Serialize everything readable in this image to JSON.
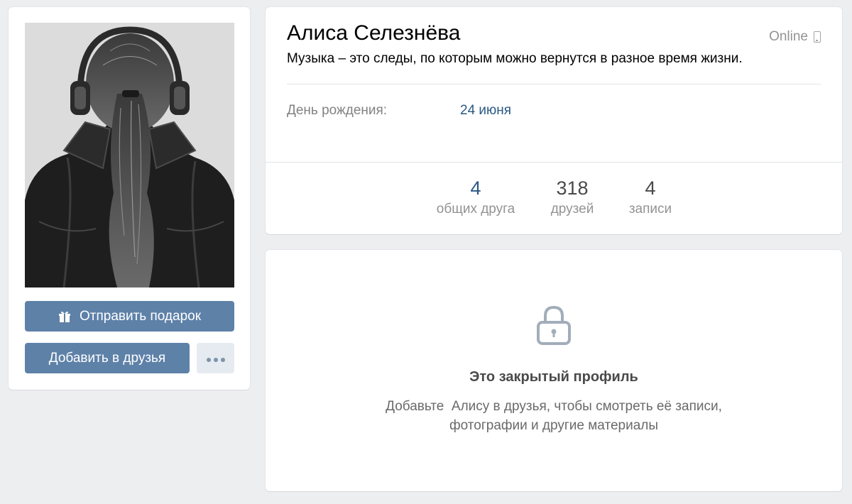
{
  "profile": {
    "name": "Алиса Селезнёва",
    "online_status": "Online",
    "status_text": "Музыка – это следы, по которым можно вернутся в разное время жизни.",
    "birthday_label": "День рождения:",
    "birthday_value": "24 июня"
  },
  "counters": [
    {
      "value": "4",
      "label": "общих друга"
    },
    {
      "value": "318",
      "label": "друзей"
    },
    {
      "value": "4",
      "label": "записи"
    }
  ],
  "actions": {
    "gift_label": "Отправить подарок",
    "add_friend_label": "Добавить в друзья"
  },
  "private": {
    "title": "Это закрытый профиль",
    "line1": "Добавьте  Алису в друзья, чтобы смотреть её записи,",
    "line2": "фотографии и другие материалы"
  },
  "colors": {
    "accent": "#5e81a8",
    "link": "#2a5885",
    "background": "#edeef0"
  },
  "icons": [
    "gift-icon",
    "phone-icon",
    "more-dots-icon",
    "lock-icon"
  ]
}
